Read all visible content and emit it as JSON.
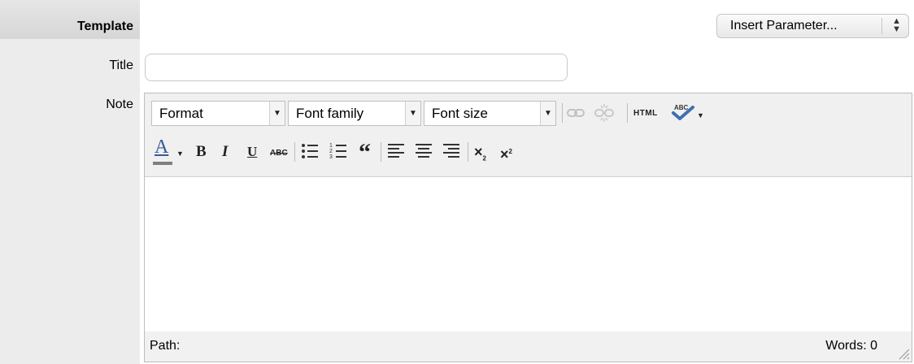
{
  "labels": {
    "template": "Template",
    "title": "Title",
    "note": "Note"
  },
  "insert_parameter": {
    "label": "Insert Parameter..."
  },
  "title_field": {
    "value": "",
    "placeholder": ""
  },
  "editor": {
    "dropdowns": {
      "format": "Format",
      "font_family": "Font family",
      "font_size": "Font size"
    },
    "toolbar": {
      "html": "HTML",
      "spellcheck": "ABC",
      "bold": "B",
      "italic": "I",
      "underline": "U",
      "strikethrough": "ABC",
      "blockquote": "“"
    },
    "content": "",
    "status": {
      "path": "Path:",
      "words": "Words: 0"
    }
  },
  "icons": [
    "link-icon",
    "unlink-icon",
    "spellcheck-icon",
    "text-color-icon",
    "bullet-list-icon",
    "numbered-list-icon",
    "align-left-icon",
    "align-center-icon",
    "align-right-icon",
    "subscript-icon",
    "superscript-icon",
    "resize-handle-icon"
  ],
  "colors": {
    "label_column": "#ececec",
    "toolbar_bg": "#f0f0f0",
    "text_color_underline": "#7f7f7f"
  }
}
